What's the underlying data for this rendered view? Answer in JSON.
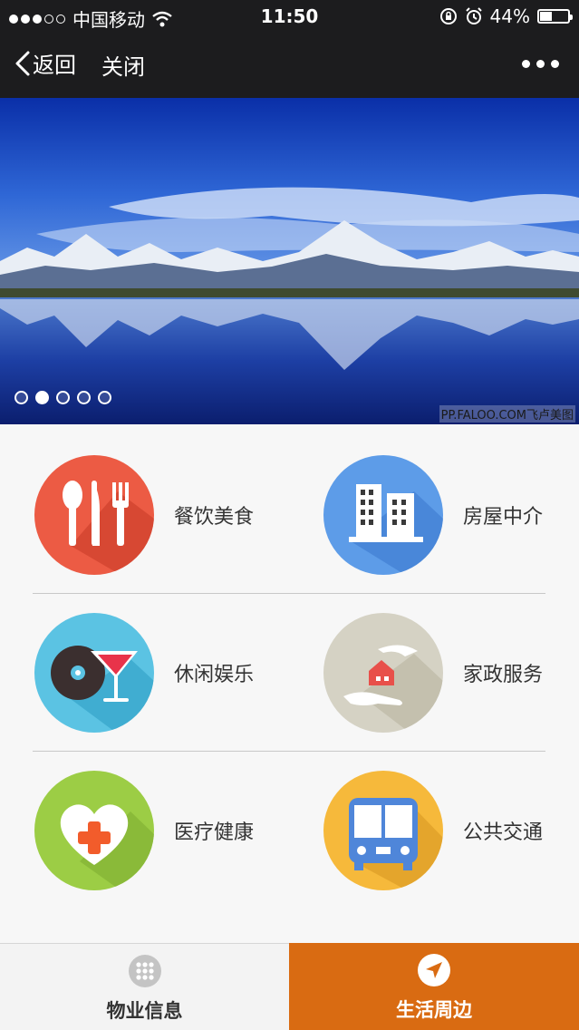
{
  "status_bar": {
    "carrier": "中国移动",
    "time": "11:50",
    "battery": "44%",
    "battery_level": 0.44
  },
  "nav": {
    "back_label": "返回",
    "close_label": "关闭"
  },
  "banner": {
    "page_count": 5,
    "active_page": 2,
    "watermark": "PP.FALOO.COM飞卢美图"
  },
  "services": [
    {
      "label": "餐饮美食",
      "icon": "utensils-icon",
      "color": "#ec5b44"
    },
    {
      "label": "房屋中介",
      "icon": "building-icon",
      "color": "#5d9ce8"
    },
    {
      "label": "休闲娱乐",
      "icon": "cocktail-icon",
      "color": "#5bc3e3"
    },
    {
      "label": "家政服务",
      "icon": "home-hands-icon",
      "color": "#d5d2c4"
    },
    {
      "label": "医疗健康",
      "icon": "health-heart-icon",
      "color": "#9ccd45"
    },
    {
      "label": "公共交通",
      "icon": "bus-icon",
      "color": "#f6b93b"
    }
  ],
  "tabs": [
    {
      "label": "物业信息",
      "icon": "grid-icon",
      "active": false
    },
    {
      "label": "生活周边",
      "icon": "location-arrow-icon",
      "active": true
    }
  ],
  "colors": {
    "accent": "#d96b12",
    "header_bg": "#1c1c1e"
  }
}
